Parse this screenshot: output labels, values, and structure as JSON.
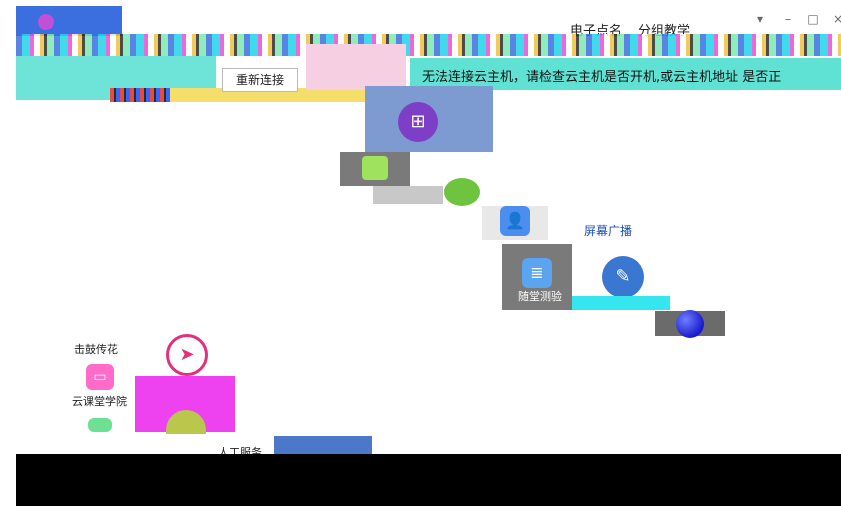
{
  "topnav": {
    "items": [
      "电子点名",
      "分组教学"
    ],
    "window_controls": [
      "▾",
      "–",
      "□",
      "×"
    ]
  },
  "banner": {
    "reconnect_label": "重新连接",
    "message": "无法连接云主机，请检查云主机是否开机,或云主机地址    是否正"
  },
  "tiles": {
    "screen_broadcast": "屏幕广播",
    "doc_label": "随堂测验"
  },
  "sidebar": {
    "items": [
      "击鼓传花",
      "云课堂学院"
    ]
  },
  "footer": {
    "service_label": "人工服务"
  },
  "colors": {
    "brand": "#3b6fe0",
    "accent_cyan": "#5fe2d4",
    "accent_magenta": "#ee42f0"
  },
  "icons": [
    "windows-icon",
    "folder-icon",
    "user-icon",
    "document-icon",
    "pen-icon",
    "laptop-icon",
    "navigation-icon"
  ]
}
